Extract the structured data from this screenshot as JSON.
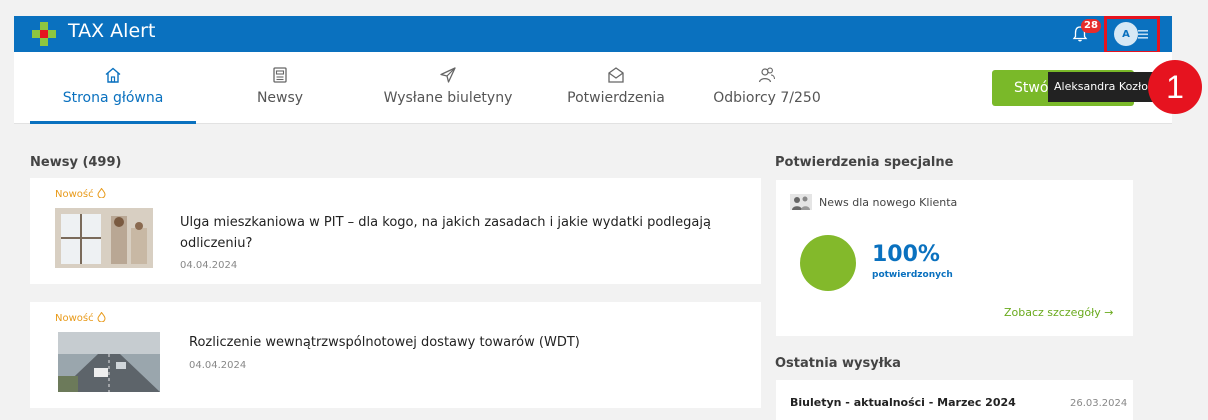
{
  "app": {
    "title": "TAX Alert",
    "notifications_count": "28",
    "avatar_initials": "A"
  },
  "nav": {
    "tabs": [
      {
        "label": "Strona główna",
        "icon": "home-icon"
      },
      {
        "label": "Newsy",
        "icon": "newspaper-icon"
      },
      {
        "label": "Wysłane biuletyny",
        "icon": "send-icon"
      },
      {
        "label": "Potwierdzenia",
        "icon": "envelope-icon"
      },
      {
        "label": "Odbiorcy 7/250",
        "icon": "users-icon"
      }
    ],
    "cta_label": "Stwó",
    "tooltip": "Aleksandra Kozło",
    "step_marker": "1"
  },
  "news": {
    "heading": "Newsy (499)",
    "items": [
      {
        "badge": "Nowość",
        "title": "Ulga mieszkaniowa w PIT – dla kogo, na jakich zasadach i jakie wydatki podlegają odliczeniu?",
        "date": "04.04.2024"
      },
      {
        "badge": "Nowość",
        "title": "Rozliczenie wewnątrzwspólnotowej dostawy towarów (WDT)",
        "date": "04.04.2024"
      }
    ]
  },
  "confirmations": {
    "heading": "Potwierdzenia specjalne",
    "item_label": "News dla nowego Klienta",
    "percent": "100%",
    "percent_label": "potwierdzonych",
    "details_link": "Zobacz szczegóły →"
  },
  "last_sent": {
    "heading": "Ostatnia wysyłka",
    "title": "Biuletyn - aktualności - Marzec 2024",
    "date": "26.03.2024"
  },
  "colors": {
    "primary": "#0a71bf",
    "accent_green": "#7ab929",
    "highlight_red": "#e6131f",
    "new_badge": "#e89a1a"
  }
}
